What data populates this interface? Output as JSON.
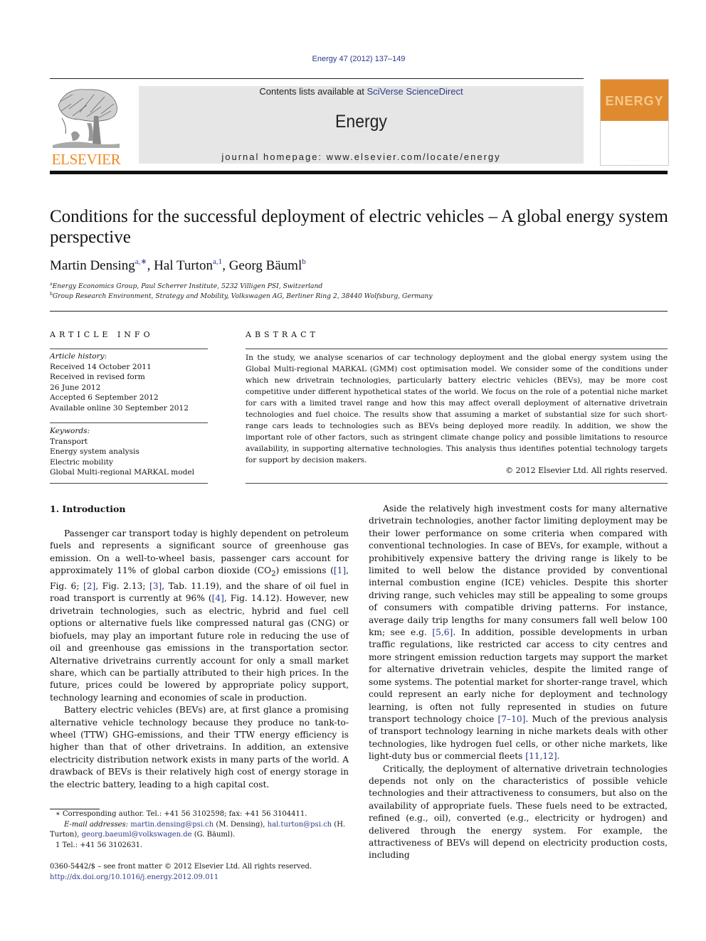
{
  "header": {
    "citation": "Energy 47 (2012) 137–149",
    "contents_prefix": "Contents lists available at ",
    "contents_link": "SciVerse ScienceDirect",
    "journal_name": "Energy",
    "homepage": "journal homepage: www.elsevier.com/locate/energy",
    "publisher_logo_text": "ELSEVIER",
    "cover_title": "ENERGY",
    "colors": {
      "publisher_orange": "#f08a24",
      "cover_orange": "#e08a30",
      "link_blue": "#2a3a8c",
      "banner_gray": "#e6e6e6"
    }
  },
  "article": {
    "title": "Conditions for the successful deployment of electric vehicles – A global energy system perspective",
    "authors": [
      {
        "name": "Martin Densing",
        "sup": "a,∗"
      },
      {
        "name": "Hal Turton",
        "sup": "a,1"
      },
      {
        "name": "Georg Bäuml",
        "sup": "b"
      }
    ],
    "affiliations": [
      {
        "mark": "a",
        "text": "Energy Economics Group, Paul Scherrer Institute, 5232 Villigen PSI, Switzerland"
      },
      {
        "mark": "b",
        "text": "Group Research Environment, Strategy and Mobility, Volkswagen AG, Berliner Ring 2, 38440 Wolfsburg, Germany"
      }
    ]
  },
  "article_info": {
    "heading": "ARTICLE INFO",
    "history_label": "Article history:",
    "history": [
      "Received 14 October 2011",
      "Received in revised form",
      "26 June 2012",
      "Accepted 6 September 2012",
      "Available online 30 September 2012"
    ],
    "keywords_label": "Keywords:",
    "keywords": [
      "Transport",
      "Energy system analysis",
      "Electric mobility",
      "Global Multi-regional MARKAL model"
    ]
  },
  "abstract": {
    "heading": "ABSTRACT",
    "text": "In the study, we analyse scenarios of car technology deployment and the global energy system using the Global Multi-regional MARKAL (GMM) cost optimisation model. We consider some of the conditions under which new drivetrain technologies, particularly battery electric vehicles (BEVs), may be more cost competitive under different hypothetical states of the world. We focus on the role of a potential niche market for cars with a limited travel range and how this may affect overall deployment of alternative drivetrain technologies and fuel choice. The results show that assuming a market of substantial size for such short-range cars leads to technologies such as BEVs being deployed more readily. In addition, we show the important role of other factors, such as stringent climate change policy and possible limitations to resource availability, in supporting alternative technologies. This analysis thus identifies potential technology targets for support by decision makers.",
    "copyright": "© 2012 Elsevier Ltd. All rights reserved."
  },
  "body": {
    "section_heading": "1.  Introduction",
    "p1": {
      "a": "Passenger car transport today is highly dependent on petroleum fuels and represents a significant source of greenhouse gas emission. On a well-to-wheel basis, passenger cars account for approximately 11% of global carbon dioxide (CO",
      "sub": "2",
      "b": ") emissions (",
      "ref1": "[1]",
      "c": ", Fig. 6; ",
      "ref2": "[2]",
      "d": ", Fig. 2.13; ",
      "ref3": "[3]",
      "e": ", Tab. 11.19), and the share of oil fuel in road transport is currently at 96% (",
      "ref4": "[4]",
      "f": ", Fig. 14.12). However, new drivetrain technologies, such as electric, hybrid and fuel cell options or alternative fuels like compressed natural gas (CNG) or biofuels, may play an important future role in reducing the use of oil and greenhouse gas emissions in the transportation sector. Alternative drivetrains currently account for only a small market share, which can be partially attributed to their high prices. In the future, prices could be lowered by appropriate policy support, technology learning and economies of scale in production."
    },
    "p2": "Battery electric vehicles (BEVs) are, at first glance a promising alternative vehicle technology because they produce no tank-to-wheel (TTW) GHG-emissions, and their TTW energy efficiency is higher than that of other drivetrains. In addition, an extensive electricity distribution network exists in many parts of the world. A drawback of BEVs is their relatively high cost of energy storage in the electric battery, leading to a high capital cost.",
    "p3": {
      "a": "Aside the relatively high investment costs for many alternative drivetrain technologies, another factor limiting deployment may be their lower performance on some criteria when compared with conventional technologies. In case of BEVs, for example, without a prohibitively expensive battery the driving range is likely to be limited to well below the distance provided by conventional internal combustion engine (ICE) vehicles. Despite this shorter driving range, such vehicles may still be appealing to some groups of consumers with compatible driving patterns. For instance, average daily trip lengths for many consumers fall well below 100 km; see e.g. ",
      "ref1": "[5,6]",
      "b": ". In addition, possible developments in urban traffic regulations, like restricted car access to city centres and more stringent emission reduction targets may support the market for alternative drivetrain vehicles, despite the limited range of some systems. The potential market for shorter-range travel, which could represent an early niche for deployment and technology learning, is often not fully represented in studies on future transport technology choice ",
      "ref2": "[7–10]",
      "c": ". Much of the previous analysis of transport technology learning in niche markets deals with other technologies, like hydrogen fuel cells, or other niche markets, like light-duty bus or commercial fleets ",
      "ref3": "[11,12]",
      "d": "."
    },
    "p4": "Critically, the deployment of alternative drivetrain technologies depends not only on the characteristics of possible vehicle technologies and their attractiveness to consumers, but also on the availability of appropriate fuels. These fuels need to be extracted, refined (e.g., oil), converted (e.g., electricity or hydrogen) and delivered through the energy system. For example, the attractiveness of BEVs will depend on electricity production costs, including"
  },
  "footnotes": {
    "corresponding": "∗  Corresponding author. Tel.: +41 56 3102598; fax: +41 56 3104411.",
    "email_label": "E-mail addresses:",
    "email1": "martin.densing@psi.ch",
    "email1_name": " (M. Densing), ",
    "email2": "hal.turton@psi.ch",
    "email2_name": " (H. Turton), ",
    "email3": "georg.baeuml@volkswagen.de",
    "email3_name": " (G. Bäuml).",
    "fn1": "1  Tel.: +41 56 3102631."
  },
  "footer": {
    "issn": "0360-5442/$ – see front matter © 2012 Elsevier Ltd. All rights reserved.",
    "doi": "http://dx.doi.org/10.1016/j.energy.2012.09.011"
  }
}
